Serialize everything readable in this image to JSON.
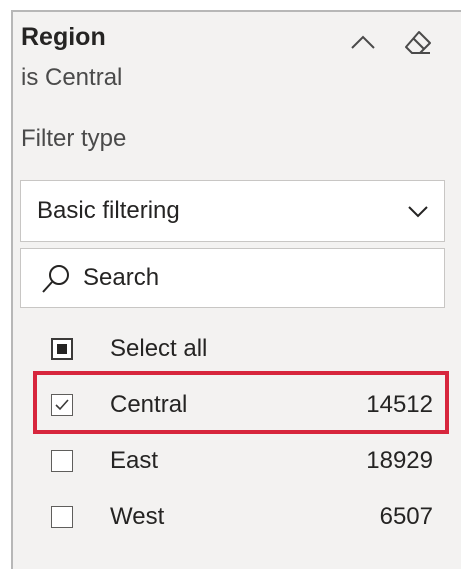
{
  "filter_card": {
    "title": "Region",
    "subtitle": "is Central",
    "filter_type_label": "Filter type",
    "filter_type_value": "Basic filtering",
    "search": {
      "placeholder": "Search",
      "value": ""
    },
    "select_all": {
      "label": "Select all",
      "state": "indeterminate"
    },
    "items": [
      {
        "label": "Central",
        "count": "14512",
        "checked": true
      },
      {
        "label": "East",
        "count": "18929",
        "checked": false
      },
      {
        "label": "West",
        "count": "6507",
        "checked": false
      }
    ],
    "highlight_color": "#d7263d"
  },
  "icons": {
    "collapse": "chevron-up-icon",
    "clear": "eraser-icon",
    "dropdown": "chevron-down-icon",
    "search": "search-icon"
  }
}
